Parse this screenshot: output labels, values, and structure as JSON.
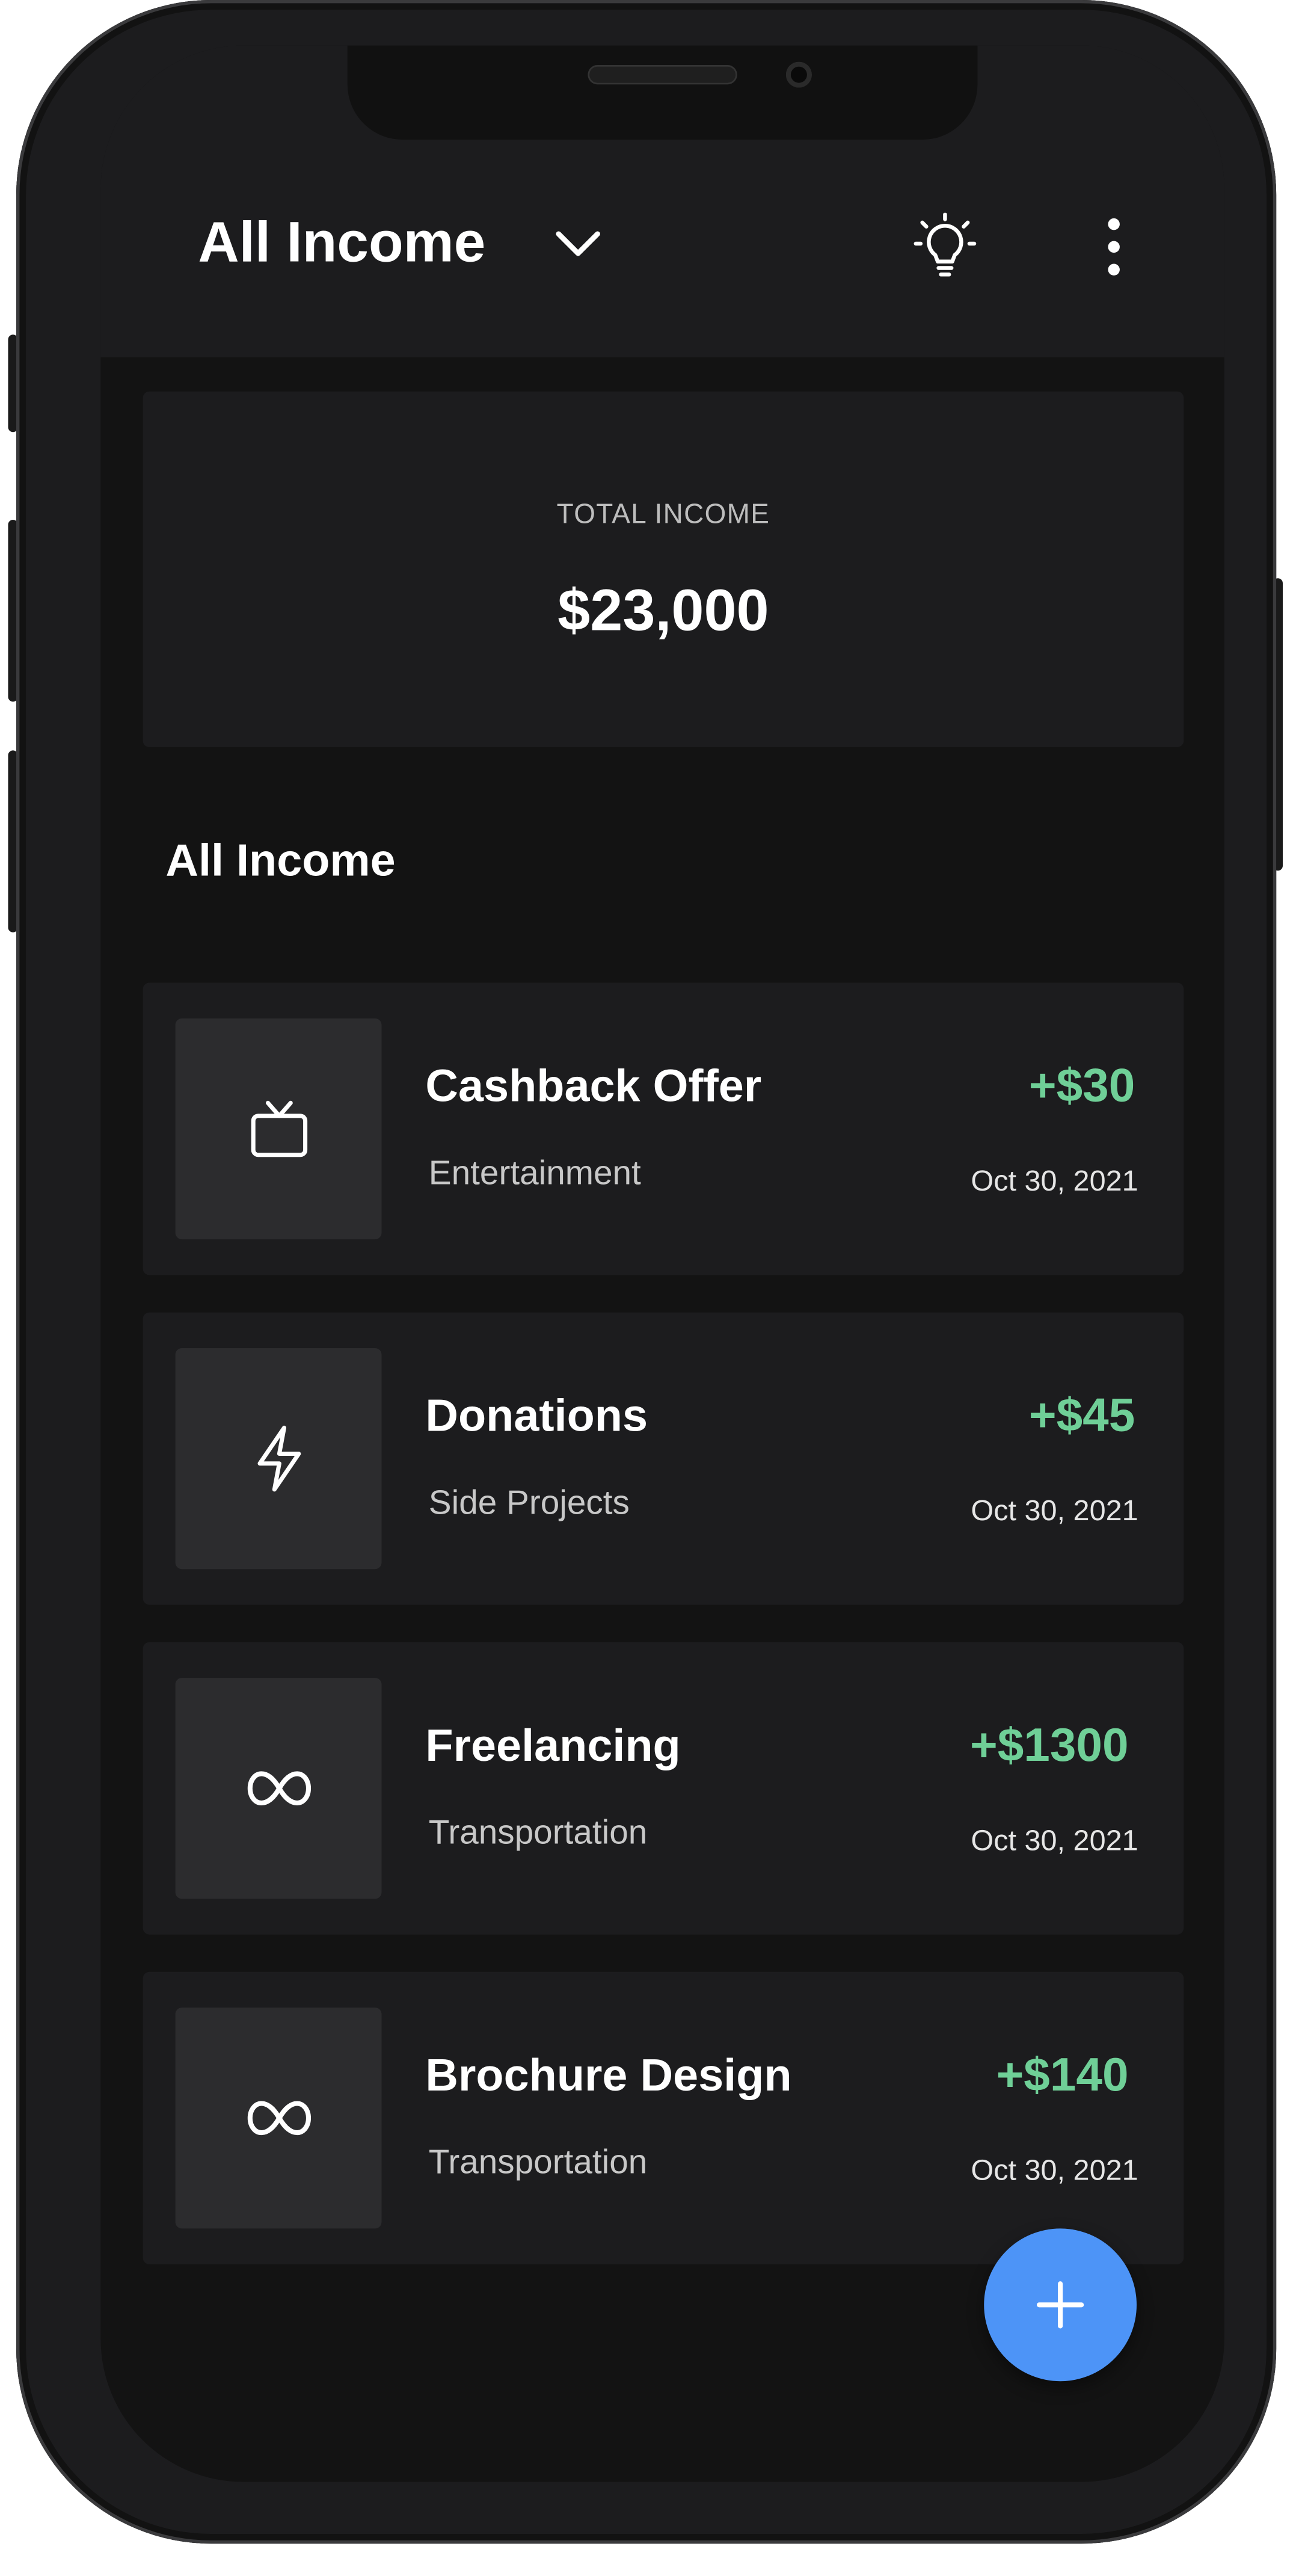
{
  "header": {
    "title": "All Income",
    "chevron_icon": "chevron-down-icon",
    "tips_icon": "lightbulb-icon",
    "menu_icon": "more-vertical-icon"
  },
  "summary": {
    "label": "TOTAL INCOME",
    "value": "$23,000"
  },
  "list": {
    "heading": "All Income",
    "items": [
      {
        "name": "Cashback Offer",
        "category": "Entertainment",
        "amount": "+$30",
        "date": "Oct 30, 2021",
        "icon": "tv-icon"
      },
      {
        "name": "Donations",
        "category": "Side Projects",
        "amount": "+$45",
        "date": "Oct 30, 2021",
        "icon": "lightning-icon"
      },
      {
        "name": "Freelancing",
        "category": "Transportation",
        "amount": "+$1300",
        "date": "Oct 30, 2021",
        "icon": "infinity-icon"
      },
      {
        "name": "Brochure Design",
        "category": "Transportation",
        "amount": "+$140",
        "date": "Oct 30, 2021",
        "icon": "infinity-icon"
      }
    ]
  },
  "fab": {
    "icon": "plus-icon"
  },
  "colors": {
    "background": "#131313",
    "surface": "#1c1c1e",
    "tile": "#2c2c2e",
    "income_green": "#6fcf97",
    "fab_blue": "#4d94f7"
  }
}
